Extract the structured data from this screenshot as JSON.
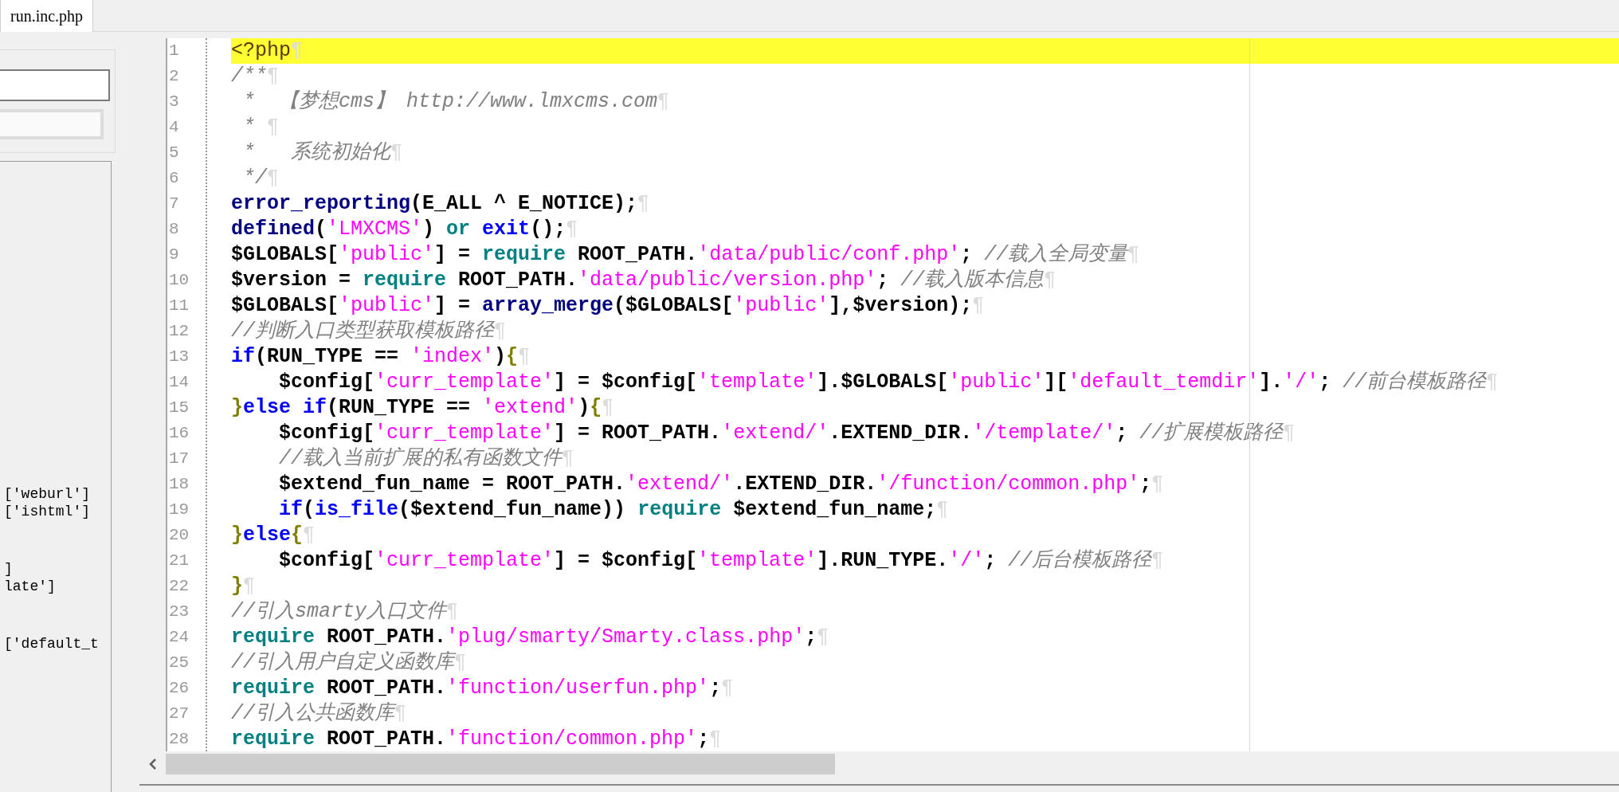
{
  "tabs": [
    {
      "label": "run.inc.php",
      "selected": true
    }
  ],
  "left_panel": {
    "fields": [
      {
        "kind": "text"
      },
      {
        "kind": "readonly"
      }
    ],
    "fragment_groups": [
      [
        "['weburl']",
        "['ishtml']"
      ],
      [
        "]",
        "late']"
      ],
      [
        "['default_t"
      ]
    ]
  },
  "editor": {
    "lines": [
      {
        "number": "1",
        "current": true,
        "eol": "¶",
        "tokens": [
          {
            "kind": "tag",
            "text": "<?php"
          }
        ]
      },
      {
        "number": "2",
        "current": false,
        "eol": "¶",
        "tokens": [
          {
            "kind": "comment",
            "text": "/**"
          }
        ]
      },
      {
        "number": "3",
        "current": false,
        "eol": "¶",
        "tokens": [
          {
            "kind": "comment",
            "text": " *  【梦想cms】 http://www.lmxcms.com"
          }
        ]
      },
      {
        "number": "4",
        "current": false,
        "eol": "¶",
        "tokens": [
          {
            "kind": "comment",
            "text": " * "
          }
        ]
      },
      {
        "number": "5",
        "current": false,
        "eol": "¶",
        "tokens": [
          {
            "kind": "comment",
            "text": " *   系统初始化"
          }
        ]
      },
      {
        "number": "6",
        "current": false,
        "eol": "¶",
        "tokens": [
          {
            "kind": "comment",
            "text": " */"
          }
        ]
      },
      {
        "number": "7",
        "current": false,
        "eol": "¶",
        "tokens": [
          {
            "kind": "function",
            "text": "error_reporting"
          },
          {
            "kind": "plain",
            "text": "(E_ALL ^ E_NOTICE);"
          }
        ]
      },
      {
        "number": "8",
        "current": false,
        "eol": "¶",
        "tokens": [
          {
            "kind": "function",
            "text": "defined"
          },
          {
            "kind": "plain",
            "text": "("
          },
          {
            "kind": "string",
            "text": "'LMXCMS'"
          },
          {
            "kind": "plain",
            "text": ") "
          },
          {
            "kind": "require",
            "text": "or "
          },
          {
            "kind": "control",
            "text": "exit"
          },
          {
            "kind": "plain",
            "text": "();"
          }
        ]
      },
      {
        "number": "9",
        "current": false,
        "eol": "¶",
        "tokens": [
          {
            "kind": "plain",
            "text": "$GLOBALS["
          },
          {
            "kind": "string",
            "text": "'public'"
          },
          {
            "kind": "plain",
            "text": "] = "
          },
          {
            "kind": "require",
            "text": "require"
          },
          {
            "kind": "plain",
            "text": " ROOT_PATH."
          },
          {
            "kind": "string",
            "text": "'data/public/conf.php'"
          },
          {
            "kind": "plain",
            "text": "; "
          },
          {
            "kind": "comment",
            "text": "//载入全局变量"
          }
        ]
      },
      {
        "number": "10",
        "current": false,
        "eol": "¶",
        "tokens": [
          {
            "kind": "plain",
            "text": "$version = "
          },
          {
            "kind": "require",
            "text": "require"
          },
          {
            "kind": "plain",
            "text": " ROOT_PATH."
          },
          {
            "kind": "string",
            "text": "'data/public/version.php'"
          },
          {
            "kind": "plain",
            "text": "; "
          },
          {
            "kind": "comment",
            "text": "//载入版本信息"
          }
        ]
      },
      {
        "number": "11",
        "current": false,
        "eol": "¶",
        "tokens": [
          {
            "kind": "plain",
            "text": "$GLOBALS["
          },
          {
            "kind": "string",
            "text": "'public'"
          },
          {
            "kind": "plain",
            "text": "] = "
          },
          {
            "kind": "function",
            "text": "array_merge"
          },
          {
            "kind": "plain",
            "text": "($GLOBALS["
          },
          {
            "kind": "string",
            "text": "'public'"
          },
          {
            "kind": "plain",
            "text": "],$version);"
          }
        ]
      },
      {
        "number": "12",
        "current": false,
        "eol": "¶",
        "tokens": [
          {
            "kind": "comment",
            "text": "//判断入口类型获取模板路径"
          }
        ]
      },
      {
        "number": "13",
        "current": false,
        "eol": "¶",
        "tokens": [
          {
            "kind": "control",
            "text": "if"
          },
          {
            "kind": "plain",
            "text": "(RUN_TYPE == "
          },
          {
            "kind": "string",
            "text": "'index'"
          },
          {
            "kind": "plain",
            "text": ")"
          },
          {
            "kind": "brace",
            "text": "{"
          }
        ]
      },
      {
        "number": "14",
        "current": false,
        "eol": "¶",
        "tokens": [
          {
            "kind": "plain",
            "text": "    $config["
          },
          {
            "kind": "string",
            "text": "'curr_template'"
          },
          {
            "kind": "plain",
            "text": "] = $config["
          },
          {
            "kind": "string",
            "text": "'template'"
          },
          {
            "kind": "plain",
            "text": "].$GLOBALS["
          },
          {
            "kind": "string",
            "text": "'public'"
          },
          {
            "kind": "plain",
            "text": "]["
          },
          {
            "kind": "string",
            "text": "'default_temdir'"
          },
          {
            "kind": "plain",
            "text": "]."
          },
          {
            "kind": "string",
            "text": "'/'"
          },
          {
            "kind": "plain",
            "text": "; "
          },
          {
            "kind": "comment",
            "text": "//前台模板路径"
          }
        ]
      },
      {
        "number": "15",
        "current": false,
        "eol": "¶",
        "tokens": [
          {
            "kind": "brace",
            "text": "}"
          },
          {
            "kind": "control",
            "text": "else if"
          },
          {
            "kind": "plain",
            "text": "(RUN_TYPE == "
          },
          {
            "kind": "string",
            "text": "'extend'"
          },
          {
            "kind": "plain",
            "text": ")"
          },
          {
            "kind": "brace",
            "text": "{"
          }
        ]
      },
      {
        "number": "16",
        "current": false,
        "eol": "¶",
        "tokens": [
          {
            "kind": "plain",
            "text": "    $config["
          },
          {
            "kind": "string",
            "text": "'curr_template'"
          },
          {
            "kind": "plain",
            "text": "] = ROOT_PATH."
          },
          {
            "kind": "string",
            "text": "'extend/'"
          },
          {
            "kind": "plain",
            "text": ".EXTEND_DIR."
          },
          {
            "kind": "string",
            "text": "'/template/'"
          },
          {
            "kind": "plain",
            "text": "; "
          },
          {
            "kind": "comment",
            "text": "//扩展模板路径"
          }
        ]
      },
      {
        "number": "17",
        "current": false,
        "eol": "¶",
        "tokens": [
          {
            "kind": "comment",
            "text": "    //载入当前扩展的私有函数文件"
          }
        ]
      },
      {
        "number": "18",
        "current": false,
        "eol": "¶",
        "tokens": [
          {
            "kind": "plain",
            "text": "    $extend_fun_name = ROOT_PATH."
          },
          {
            "kind": "string",
            "text": "'extend/'"
          },
          {
            "kind": "plain",
            "text": ".EXTEND_DIR."
          },
          {
            "kind": "string",
            "text": "'/function/common.php'"
          },
          {
            "kind": "plain",
            "text": ";"
          }
        ]
      },
      {
        "number": "19",
        "current": false,
        "eol": "¶",
        "tokens": [
          {
            "kind": "control",
            "text": "    if"
          },
          {
            "kind": "plain",
            "text": "("
          },
          {
            "kind": "control",
            "text": "is_file"
          },
          {
            "kind": "plain",
            "text": "($extend_fun_name)) "
          },
          {
            "kind": "require",
            "text": "require"
          },
          {
            "kind": "plain",
            "text": " $extend_fun_name;"
          }
        ]
      },
      {
        "number": "20",
        "current": false,
        "eol": "¶",
        "tokens": [
          {
            "kind": "brace",
            "text": "}"
          },
          {
            "kind": "control",
            "text": "else"
          },
          {
            "kind": "brace",
            "text": "{"
          }
        ]
      },
      {
        "number": "21",
        "current": false,
        "eol": "¶",
        "tokens": [
          {
            "kind": "plain",
            "text": "    $config["
          },
          {
            "kind": "string",
            "text": "'curr_template'"
          },
          {
            "kind": "plain",
            "text": "] = $config["
          },
          {
            "kind": "string",
            "text": "'template'"
          },
          {
            "kind": "plain",
            "text": "].RUN_TYPE."
          },
          {
            "kind": "string",
            "text": "'/'"
          },
          {
            "kind": "plain",
            "text": "; "
          },
          {
            "kind": "comment",
            "text": "//后台模板路径"
          }
        ]
      },
      {
        "number": "22",
        "current": false,
        "eol": "¶",
        "tokens": [
          {
            "kind": "brace",
            "text": "}"
          }
        ]
      },
      {
        "number": "23",
        "current": false,
        "eol": "¶",
        "tokens": [
          {
            "kind": "comment",
            "text": "//引入smarty入口文件"
          }
        ]
      },
      {
        "number": "24",
        "current": false,
        "eol": "¶",
        "tokens": [
          {
            "kind": "require",
            "text": "require"
          },
          {
            "kind": "plain",
            "text": " ROOT_PATH."
          },
          {
            "kind": "string",
            "text": "'plug/smarty/Smarty.class.php'"
          },
          {
            "kind": "plain",
            "text": ";"
          }
        ]
      },
      {
        "number": "25",
        "current": false,
        "eol": "¶",
        "tokens": [
          {
            "kind": "comment",
            "text": "//引入用户自定义函数库"
          }
        ]
      },
      {
        "number": "26",
        "current": false,
        "eol": "¶",
        "tokens": [
          {
            "kind": "require",
            "text": "require"
          },
          {
            "kind": "plain",
            "text": " ROOT_PATH."
          },
          {
            "kind": "string",
            "text": "'function/userfun.php'"
          },
          {
            "kind": "plain",
            "text": ";"
          }
        ]
      },
      {
        "number": "27",
        "current": false,
        "eol": "¶",
        "tokens": [
          {
            "kind": "comment",
            "text": "//引入公共函数库"
          }
        ]
      },
      {
        "number": "28",
        "current": false,
        "eol": "¶",
        "tokens": [
          {
            "kind": "require",
            "text": "require"
          },
          {
            "kind": "plain",
            "text": " ROOT_PATH."
          },
          {
            "kind": "string",
            "text": "'function/common.php'"
          },
          {
            "kind": "plain",
            "text": ";"
          }
        ]
      }
    ]
  }
}
